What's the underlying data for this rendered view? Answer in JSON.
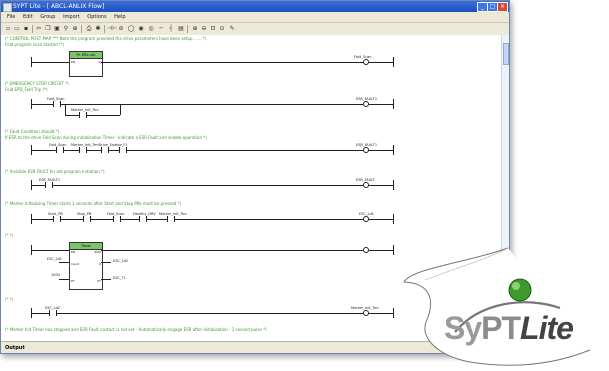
{
  "window": {
    "title": "SYPT Lite - [ ABCL-ANLIX Flow]",
    "buttons": {
      "minimize": "_",
      "maximize": "□",
      "close": "×"
    }
  },
  "menu": [
    "File",
    "Edit",
    "Group",
    "Import",
    "Options",
    "Help"
  ],
  "statusbar": {
    "label": "Output"
  },
  "logo": {
    "part1": "Sy",
    "part2": "PT",
    "part3": "Lite"
  },
  "rungs": [
    {
      "comment": "(* CONTROL POST MAP *** Note the program provided the drive parameters have been setup ...... *)",
      "sub": "Fold program scan started (*)",
      "block": {
        "name": "Pr. ERL=sh",
        "pins": {
          "en": "EN",
          "q": "Q"
        }
      },
      "coil_label": "Fold_Scan"
    },
    {
      "comment": "(* EMERGENCY STOP CIRCUIT *)",
      "sub": "Fold EPD_Fold Trip (*)",
      "contacts": [
        "Fold_Scan",
        "Marker_Init_Trm"
      ],
      "coil_label": "ESR_FAULT1"
    },
    {
      "comment": "(* Fault Condition should *)",
      "sub": "If ESR to the drive Fold Scan during initialisation Timer - indicate a ESR Fault and enable operation *)",
      "contacts": [
        "Fold_Scan",
        "Marker_Init_TrmDrive_Enable_F1"
      ],
      "coil_label": "ESR_FAULT1"
    },
    {
      "comment": "(* Invisible ESR FAULT for old program initiation *)",
      "contacts": [
        "ESR_FAULT1"
      ],
      "coil_label": "ESR_FAULT"
    },
    {
      "comment": "(* Marker Initialising Timer starts 1 seconds after Start and Stop PBs must be pressed *)",
      "contacts": [
        "Start_PB",
        "Stop_PB",
        "Fold_Scan",
        "Healthy_DRV",
        "Marker_Init_Trm"
      ],
      "coil_label": "ESC_Ld1"
    },
    {
      "comment": "(* *)",
      "block": {
        "name": "Timer",
        "pins": {
          "en": "EN",
          "eno": "ENO",
          "in": "Input",
          "pt": "PT",
          "q": "Q",
          "et": "ET"
        }
      },
      "inputs": [
        "ESC_Ld1",
        "1000"
      ],
      "outputs": [
        "ESC_Ld2",
        "ESC_T1"
      ]
    },
    {
      "comment": "(* *)",
      "contacts": [
        "ESC_Ld2"
      ],
      "coil_label": "Marker_Init_Trm"
    },
    {
      "comment": "(* Marker Init Timer has stopped and ESR Fault contact is not set - Automatically engage ESR after initialisation - 1 second pulse *)"
    }
  ]
}
